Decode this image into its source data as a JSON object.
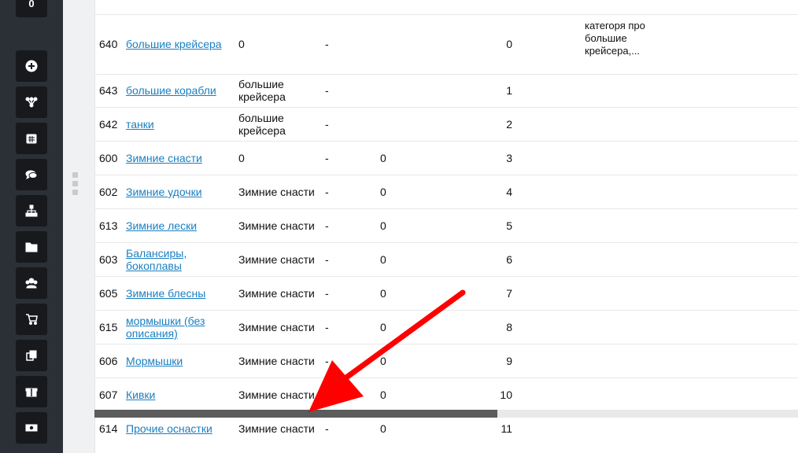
{
  "sidebar": {
    "top_badge": "0",
    "icons": [
      "plus-circle-icon",
      "sitemap-icon",
      "calendar-icon",
      "comments-icon",
      "hierarchy-icon",
      "folder-icon",
      "users-icon",
      "cart-icon",
      "copy-icon",
      "gift-icon",
      "money-icon"
    ]
  },
  "table": {
    "rows": [
      {
        "id": "640",
        "name": "большие крейсера",
        "parent": "0",
        "dash": "-",
        "zero": "",
        "order": "0",
        "desc": "категоря про большие крейсера,..."
      },
      {
        "id": "643",
        "name": "большие корабли",
        "parent": "большие крейсера",
        "dash": "-",
        "zero": "",
        "order": "1",
        "desc": ""
      },
      {
        "id": "642",
        "name": "танки",
        "parent": "большие крейсера",
        "dash": "-",
        "zero": "",
        "order": "2",
        "desc": ""
      },
      {
        "id": "600",
        "name": "Зимние снасти",
        "parent": "0",
        "dash": "-",
        "zero": "0",
        "order": "3",
        "desc": ""
      },
      {
        "id": "602",
        "name": "Зимние удочки",
        "parent": "Зимние снасти",
        "dash": "-",
        "zero": "0",
        "order": "4",
        "desc": ""
      },
      {
        "id": "613",
        "name": "Зимние лески",
        "parent": "Зимние снасти",
        "dash": "-",
        "zero": "0",
        "order": "5",
        "desc": ""
      },
      {
        "id": "603",
        "name": "Балансиры, бокоплавы",
        "parent": "Зимние снасти",
        "dash": "-",
        "zero": "0",
        "order": "6",
        "desc": ""
      },
      {
        "id": "605",
        "name": "Зимние блесны",
        "parent": "Зимние снасти",
        "dash": "-",
        "zero": "0",
        "order": "7",
        "desc": ""
      },
      {
        "id": "615",
        "name": "мормышки (без описания)",
        "parent": "Зимние снасти",
        "dash": "-",
        "zero": "0",
        "order": "8",
        "desc": ""
      },
      {
        "id": "606",
        "name": "Мормышки",
        "parent": "Зимние снасти",
        "dash": "-",
        "zero": "0",
        "order": "9",
        "desc": ""
      },
      {
        "id": "607",
        "name": "Кивки",
        "parent": "Зимние снасти",
        "dash": "-",
        "zero": "0",
        "order": "10",
        "desc": ""
      },
      {
        "id": "614",
        "name": "Прочие оснастки",
        "parent": "Зимние снасти",
        "dash": "-",
        "zero": "0",
        "order": "11",
        "desc": ""
      }
    ]
  },
  "scrollbar": {
    "position_fraction": 0.57
  },
  "colors": {
    "link": "#1a7fc1",
    "sidebar": "#2b2f36",
    "arrow": "#ff0000"
  }
}
